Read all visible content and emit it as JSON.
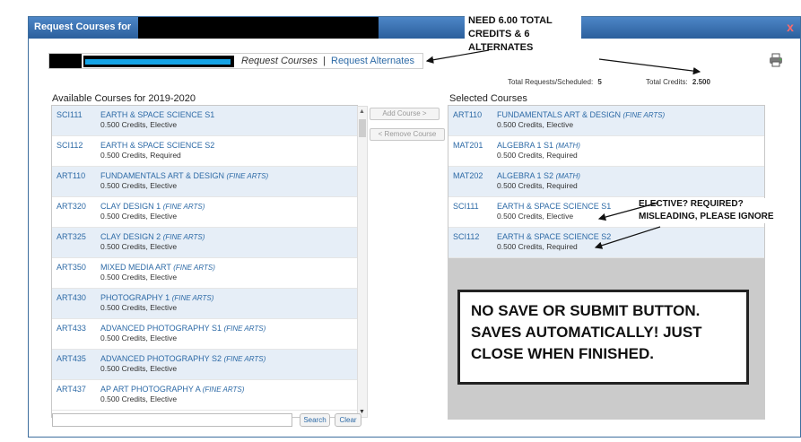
{
  "window": {
    "title": "Request Courses for",
    "close_label": "x"
  },
  "tabs": {
    "active": "Request Courses",
    "separator": "|",
    "alternates": "Request Alternates"
  },
  "totals": {
    "requests_label": "Total Requests/Scheduled:",
    "requests_value": "5",
    "credits_label": "Total Credits:",
    "credits_value": "2.500"
  },
  "available": {
    "heading": "Available Courses for 2019-2020",
    "courses": [
      {
        "code": "SCI111",
        "name": "EARTH & SPACE SCIENCE S1",
        "dept": "",
        "info": "0.500 Credits,  Elective"
      },
      {
        "code": "SCI112",
        "name": "EARTH & SPACE SCIENCE S2",
        "dept": "",
        "info": "0.500 Credits,  Required"
      },
      {
        "code": "ART110",
        "name": "FUNDAMENTALS ART & DESIGN",
        "dept": "(FINE ARTS)",
        "info": "0.500 Credits,  Elective"
      },
      {
        "code": "ART320",
        "name": "CLAY DESIGN 1",
        "dept": "(FINE ARTS)",
        "info": "0.500 Credits,  Elective"
      },
      {
        "code": "ART325",
        "name": "CLAY DESIGN 2",
        "dept": "(FINE ARTS)",
        "info": "0.500 Credits,  Elective"
      },
      {
        "code": "ART350",
        "name": "MIXED MEDIA ART",
        "dept": "(FINE ARTS)",
        "info": "0.500 Credits,  Elective"
      },
      {
        "code": "ART430",
        "name": "PHOTOGRAPHY 1",
        "dept": "(FINE ARTS)",
        "info": "0.500 Credits,  Elective"
      },
      {
        "code": "ART433",
        "name": "ADVANCED PHOTOGRAPHY S1",
        "dept": "(FINE ARTS)",
        "info": "0.500 Credits,  Elective"
      },
      {
        "code": "ART435",
        "name": "ADVANCED PHOTOGRAPHY S2",
        "dept": "(FINE ARTS)",
        "info": "0.500 Credits,  Elective"
      },
      {
        "code": "ART437",
        "name": "AP ART PHOTOGRAPHY A",
        "dept": "(FINE ARTS)",
        "info": "0.500 Credits,  Elective"
      }
    ]
  },
  "selected": {
    "heading": "Selected Courses",
    "courses": [
      {
        "code": "ART110",
        "name": "FUNDAMENTALS ART & DESIGN",
        "dept": "(FINE ARTS)",
        "info": "0.500 Credits,  Elective"
      },
      {
        "code": "MAT201",
        "name": "ALGEBRA 1 S1",
        "dept": "(MATH)",
        "info": "0.500 Credits,  Required"
      },
      {
        "code": "MAT202",
        "name": "ALGEBRA 1 S2",
        "dept": "(MATH)",
        "info": "0.500 Credits,  Required"
      },
      {
        "code": "SCI111",
        "name": "EARTH & SPACE SCIENCE S1",
        "dept": "",
        "info": "0.500 Credits,  Elective"
      },
      {
        "code": "SCI112",
        "name": "EARTH & SPACE SCIENCE S2",
        "dept": "",
        "info": "0.500 Credits,  Required"
      }
    ]
  },
  "buttons": {
    "add": "Add Course >",
    "remove": "< Remove Course",
    "search": "Search",
    "clear": "Clear"
  },
  "search": {
    "value": "",
    "placeholder": ""
  },
  "annotations": {
    "need_credits": "NEED 6.00 TOTAL CREDITS & 6 ALTERNATES",
    "elective_note": "ELECTIVE? REQUIRED? MISLEADING, PLEASE IGNORE",
    "save_note": "NO SAVE OR SUBMIT BUTTON. SAVES AUTOMATICALLY! JUST CLOSE WHEN FINISHED."
  },
  "icons": {
    "print": "printer-icon",
    "scroll_up": "scroll-up-icon",
    "scroll_down": "scroll-down-icon"
  },
  "colors": {
    "title_bar": "#2b5f9c",
    "link": "#2d6aa6",
    "selected_bg": "#cbcbcb",
    "row_alt": "#e6eef7"
  }
}
